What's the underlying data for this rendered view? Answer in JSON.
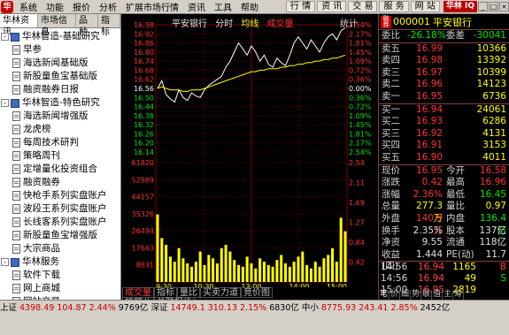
{
  "menubar": {
    "items": [
      "系统",
      "功能",
      "报价",
      "分析",
      "扩展市场行情",
      "资讯",
      "工具",
      "帮助"
    ],
    "tools": [
      "行 情",
      "资 讯",
      "交 易",
      "服 务",
      "网 站"
    ],
    "brand": "华林 IQ",
    "window_buttons": [
      "_",
      "□",
      "×"
    ]
  },
  "left": {
    "tabs": [
      "华林资讯",
      "市场信息",
      "品种",
      "指标"
    ],
    "tree": [
      {
        "level": 1,
        "toggle": "-",
        "label": "华林智造-基础研究"
      },
      {
        "level": 2,
        "label": "早参"
      },
      {
        "level": 2,
        "label": "海选新闻基础版"
      },
      {
        "level": 2,
        "label": "新股童鱼宝基础版"
      },
      {
        "level": 2,
        "label": "融资融券日报"
      },
      {
        "level": 1,
        "toggle": "-",
        "label": "华林智造-特色研究"
      },
      {
        "level": 2,
        "label": "海选新闻增强版"
      },
      {
        "level": 2,
        "label": "龙虎榜"
      },
      {
        "level": 2,
        "label": "每周技术研判"
      },
      {
        "level": 2,
        "label": "策略周刊"
      },
      {
        "level": 2,
        "label": "定增量化投资组合"
      },
      {
        "level": 2,
        "label": "融资融券"
      },
      {
        "level": 2,
        "label": "快枪手系列实盘账户"
      },
      {
        "level": 2,
        "label": "波段王系列实盘账户"
      },
      {
        "level": 2,
        "label": "长线客系列实盘账户"
      },
      {
        "level": 2,
        "label": "新股童鱼宝增强版"
      },
      {
        "level": 2,
        "label": "大宗商品"
      },
      {
        "level": 1,
        "toggle": "-",
        "label": "华林服务"
      },
      {
        "level": 2,
        "label": "软件下载"
      },
      {
        "level": 2,
        "label": "网上商城"
      },
      {
        "level": 2,
        "label": "网站交易"
      },
      {
        "level": 2,
        "label": "自助开户"
      }
    ]
  },
  "chart": {
    "title": [
      "平安银行",
      "分时",
      "均线",
      "成交量"
    ],
    "stat_label": "统计",
    "bottom_tabs": [
      "成交量",
      "指标",
      "量比",
      "买卖力道",
      "竞价图"
    ],
    "bottom_tabs2": [
      "扩展八",
      "关联报价"
    ],
    "colors": {
      "price": "#ffffff",
      "avg": "#ffff00",
      "up": "#ff3232",
      "down": "#00e600",
      "grid": "#7a0000",
      "vol": "#ffff00"
    },
    "chart_data": {
      "type": "line",
      "series": [
        {
          "name": "分时",
          "values": [
            16.56,
            16.61,
            16.52,
            16.49,
            16.47,
            16.55,
            16.5,
            16.48,
            16.53,
            16.51,
            16.5,
            16.55,
            16.58,
            16.6,
            16.62,
            16.64,
            16.7,
            16.74,
            16.8,
            16.86,
            16.82,
            16.78,
            16.84,
            16.8,
            16.74,
            16.78,
            16.72,
            16.7,
            16.76,
            16.73,
            16.71,
            16.78,
            16.86,
            16.9,
            16.86,
            16.82,
            16.88,
            16.84,
            16.8,
            16.86,
            16.9,
            16.92,
            16.88,
            16.94,
            16.96
          ]
        },
        {
          "name": "均线",
          "values": [
            16.56,
            16.57,
            16.56,
            16.55,
            16.55,
            16.55,
            16.54,
            16.54,
            16.55,
            16.55,
            16.55,
            16.56,
            16.57,
            16.58,
            16.59,
            16.6,
            16.61,
            16.62,
            16.63,
            16.64,
            16.65,
            16.66,
            16.67,
            16.67,
            16.68,
            16.68,
            16.69,
            16.69,
            16.69,
            16.7,
            16.7,
            16.71,
            16.71,
            16.72,
            16.72,
            16.73,
            16.73,
            16.74,
            16.74,
            16.75,
            16.75,
            16.76,
            16.76,
            16.77,
            16.78
          ]
        }
      ],
      "volume": [
        40000,
        26000,
        22000,
        15000,
        12000,
        20000,
        14000,
        11000,
        9000,
        12000,
        18000,
        10000,
        16000,
        14000,
        11000,
        20000,
        22000,
        18000,
        13000,
        10000,
        9000,
        15000,
        11000,
        8000,
        14000,
        12000,
        10000,
        9000,
        13000,
        16000,
        11000,
        9000,
        12000,
        15000,
        18000,
        10000,
        8000,
        12000,
        9000,
        14000,
        16000,
        20000,
        12000,
        38000,
        30000
      ],
      "ylim": [
        16.14,
        16.98
      ],
      "y_ticks_left": [
        "16.98",
        "16.92",
        "16.86",
        "16.80",
        "16.74",
        "16.68",
        "16.62",
        "16.56",
        "16.50",
        "16.44",
        "16.38",
        "16.32",
        "16.26",
        "16.20",
        "16.14"
      ],
      "y_ticks_right": [
        "2.54%",
        "2.17%",
        "1.81%",
        "1.45%",
        "1.09%",
        "0.72%",
        "0.36%",
        "0.00%",
        "0.36%",
        "0.72%",
        "1.09%",
        "1.45%",
        "1.81%",
        "2.17%",
        "2.54%"
      ],
      "vol_ticks": [
        "61820",
        "52989",
        "44157",
        "35326",
        "26494",
        "17663",
        "8831"
      ],
      "vol_ticks_right": [
        "2.54",
        "2.11",
        "1.69",
        "1.27",
        "0.84",
        "0.42"
      ],
      "x_ticks": [
        "9:30",
        "10:30",
        "13:00",
        "14:00",
        "15:00"
      ]
    }
  },
  "quote": {
    "code": "000001",
    "name": "平安银行",
    "weibi": {
      "label": "委比",
      "value": "-26.18%",
      "label2": "委差",
      "value2": "-30041"
    },
    "sells": [
      {
        "label": "卖五",
        "price": "16.99",
        "vol": "10366"
      },
      {
        "label": "卖四",
        "price": "16.98",
        "vol": "13392"
      },
      {
        "label": "卖三",
        "price": "16.97",
        "vol": "10399"
      },
      {
        "label": "卖二",
        "price": "16.96",
        "vol": "14123"
      },
      {
        "label": "卖一",
        "price": "16.95",
        "vol": "6736"
      }
    ],
    "buys": [
      {
        "label": "买一",
        "price": "16.94",
        "vol": "24061"
      },
      {
        "label": "买二",
        "price": "16.93",
        "vol": "6286"
      },
      {
        "label": "买三",
        "price": "16.92",
        "vol": "4131"
      },
      {
        "label": "买四",
        "price": "16.91",
        "vol": "3153"
      },
      {
        "label": "买五",
        "price": "16.90",
        "vol": "4011"
      }
    ],
    "stats": [
      {
        "a": "现价",
        "b": "16.95",
        "bc": "red",
        "c": "今开",
        "d": "16.58",
        "dc": "red"
      },
      {
        "a": "涨跌",
        "b": "0.42",
        "bc": "red",
        "c": "最高",
        "d": "16.96",
        "dc": "red"
      },
      {
        "a": "涨幅",
        "b": "2.36%",
        "bc": "red",
        "c": "最低",
        "d": "16.45",
        "dc": "green"
      },
      {
        "a": "总量",
        "b": "277.3万",
        "bc": "yellow",
        "c": "量比",
        "d": "0.97",
        "dc": "yellow"
      },
      {
        "a": "外盘",
        "b": "140.9万",
        "bc": "red",
        "c": "内盘",
        "d": "136.4万",
        "dc": "green"
      },
      {
        "a": "换手",
        "b": "2.35%",
        "bc": "white",
        "c": "股本",
        "d": "137亿",
        "dc": "white"
      },
      {
        "a": "净资",
        "b": "9.55",
        "bc": "white",
        "c": "流通",
        "d": "118亿",
        "dc": "white"
      },
      {
        "a": "收益(四)",
        "b": "1.444",
        "bc": "white",
        "c": "PE(动)",
        "d": "11.7",
        "dc": "white"
      }
    ],
    "trades": [
      {
        "time": "14:56",
        "price": "16.94",
        "vol": "1165",
        "flag": "B",
        "fc": "red"
      },
      {
        "time": "14:56",
        "price": "16.94",
        "vol": "49",
        "flag": "S",
        "fc": "green"
      },
      {
        "time": "15:00",
        "price": "16.95",
        "vol": "2819",
        "flag": "",
        "fc": "white"
      }
    ],
    "tabs": [
      "笔",
      "价",
      "细",
      "势",
      "联",
      "值",
      "主",
      "筹"
    ]
  },
  "status": {
    "items": [
      {
        "label": "上证",
        "value": "4398.49",
        "chg": "104.87",
        "pct": "2.44%",
        "amt": "9769亿"
      },
      {
        "label": "深证",
        "value": "14749.1",
        "chg": "310.13",
        "pct": "2.15%",
        "amt": "6830亿"
      },
      {
        "label": "中小",
        "value": "8775.93",
        "chg": "243.41",
        "pct": "2.85%",
        "amt": "2452亿"
      }
    ]
  }
}
